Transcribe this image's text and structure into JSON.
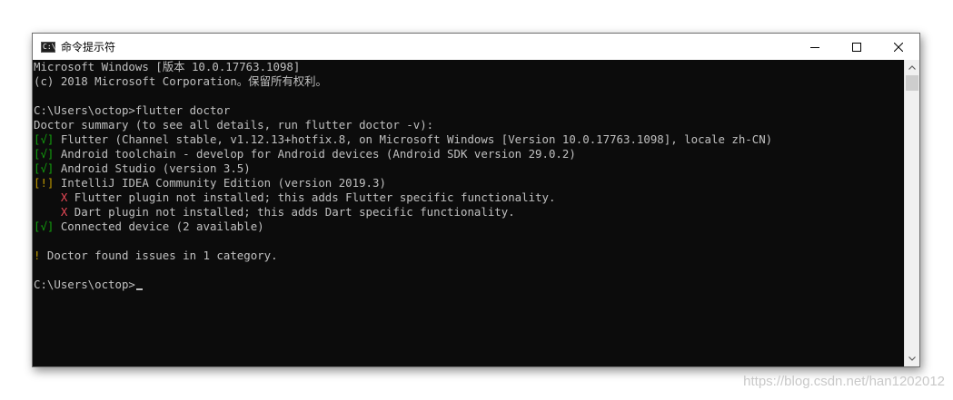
{
  "window": {
    "icon_glyph": "C:\\",
    "title": "命令提示符"
  },
  "terminal": {
    "lines": [
      {
        "text": "Microsoft Windows [版本 10.0.17763.1098]"
      },
      {
        "text": "(c) 2018 Microsoft Corporation。保留所有权利。"
      },
      {
        "text": ""
      },
      {
        "text": "C:\\Users\\octop>flutter doctor"
      },
      {
        "text": "Doctor summary (to see all details, run flutter doctor -v):"
      },
      {
        "prefix": "[√]",
        "status": "ok",
        "text": " Flutter (Channel stable, v1.12.13+hotfix.8, on Microsoft Windows [Version 10.0.17763.1098], locale zh-CN)"
      },
      {
        "prefix": "[√]",
        "status": "ok",
        "text": " Android toolchain - develop for Android devices (Android SDK version 29.0.2)"
      },
      {
        "prefix": "[√]",
        "status": "ok",
        "text": " Android Studio (version 3.5)"
      },
      {
        "prefix": "[!]",
        "status": "warn",
        "text": " IntelliJ IDEA Community Edition (version 2019.3)"
      },
      {
        "indent": "    ",
        "prefix": "X",
        "status": "err",
        "text": " Flutter plugin not installed; this adds Flutter specific functionality."
      },
      {
        "indent": "    ",
        "prefix": "X",
        "status": "err",
        "text": " Dart plugin not installed; this adds Dart specific functionality."
      },
      {
        "prefix": "[√]",
        "status": "ok",
        "text": " Connected device (2 available)"
      },
      {
        "text": ""
      },
      {
        "prefix": "!",
        "status": "warn",
        "text": " Doctor found issues in 1 category."
      },
      {
        "text": ""
      },
      {
        "text": "C:\\Users\\octop>",
        "cursor": true
      }
    ]
  },
  "colors": {
    "background": "#0c0c0c",
    "foreground": "#c0c0c0",
    "ok": "#13a10e",
    "warn": "#c19c00",
    "err": "#e74856"
  },
  "icons": {
    "minimize": "minimize-icon",
    "maximize": "maximize-icon",
    "close": "close-icon",
    "scroll_up": "scroll-up-arrow-icon",
    "scroll_down": "scroll-down-arrow-icon"
  },
  "watermark": "https://blog.csdn.net/han1202012"
}
